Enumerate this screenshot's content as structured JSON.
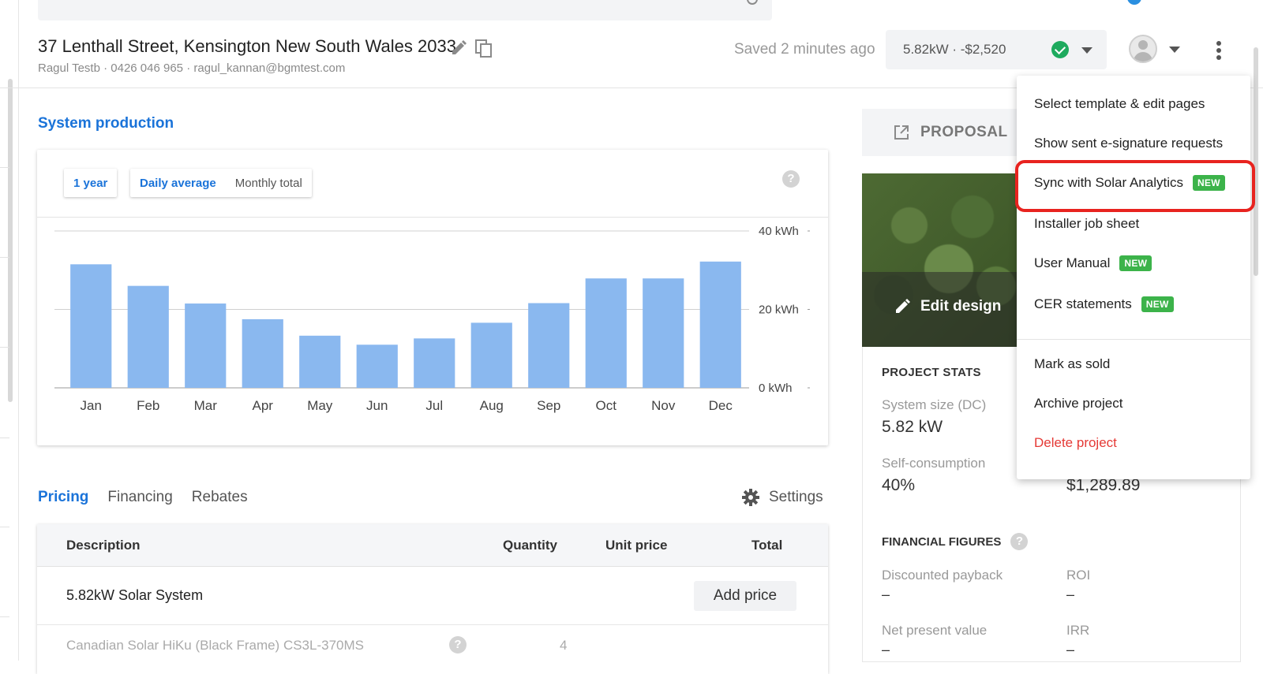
{
  "header": {
    "address": "37 Lenthall Street, Kensington New South Wales 2033",
    "contact": "Ragul Testb · 0426 046 965 · ragul_kannan@bgmtest.com",
    "saved_status": "Saved 2 minutes ago",
    "system_summary": "5.82kW · -$2,520"
  },
  "production": {
    "title": "System production",
    "period_button": "1 year",
    "toggle_daily": "Daily average",
    "toggle_monthly": "Monthly total",
    "help_glyph": "?"
  },
  "chart_data": {
    "type": "bar",
    "categories": [
      "Jan",
      "Feb",
      "Mar",
      "Apr",
      "May",
      "Jun",
      "Jul",
      "Aug",
      "Sep",
      "Oct",
      "Nov",
      "Dec"
    ],
    "values": [
      31.5,
      26,
      21.5,
      17.5,
      13.3,
      11,
      12.6,
      16.6,
      21.6,
      27.9,
      27.9,
      32.2
    ],
    "ylim": [
      0,
      40
    ],
    "yticks": [
      {
        "value": 40,
        "label": "40 kWh"
      },
      {
        "value": 20,
        "label": "20 kWh"
      },
      {
        "value": 0,
        "label": "0 kWh"
      }
    ],
    "bar_color": "#8ab8ef",
    "grid": true
  },
  "pricing": {
    "tabs": [
      "Pricing",
      "Financing",
      "Rebates"
    ],
    "settings_label": "Settings",
    "columns": {
      "description": "Description",
      "quantity": "Quantity",
      "unit_price": "Unit price",
      "total": "Total"
    },
    "rows": [
      {
        "description": "5.82kW Solar System",
        "action": "Add price"
      },
      {
        "description": "Canadian Solar HiKu (Black Frame) CS3L-370MS",
        "quantity": "4"
      }
    ]
  },
  "right_panel": {
    "proposal_label": "PROPOSAL",
    "edit_design_label": "Edit design",
    "project_stats_title": "PROJECT STATS",
    "system_size_label": "System size (DC)",
    "system_size_value": "5.82 kW",
    "self_consumption_label": "Self-consumption",
    "self_consumption_value": "40%",
    "partial_value": "$1,289.89",
    "financial_title": "FINANCIAL FIGURES",
    "discounted_payback_label": "Discounted payback",
    "discounted_payback_value": "–",
    "roi_label": "ROI",
    "roi_value": "–",
    "npv_label": "Net present value",
    "npv_value": "–",
    "irr_label": "IRR",
    "irr_value": "–"
  },
  "menu": {
    "items": [
      {
        "label": "Select template & edit pages"
      },
      {
        "label": "Show sent e-signature requests"
      },
      {
        "label": "Sync with Solar Analytics",
        "badge": "NEW"
      },
      {
        "label": "Installer job sheet"
      },
      {
        "label": "User Manual",
        "badge": "NEW"
      },
      {
        "label": "CER statements",
        "badge": "NEW"
      },
      {
        "label": "Mark as sold"
      },
      {
        "label": "Archive project"
      },
      {
        "label": "Delete project"
      }
    ]
  },
  "colors": {
    "accent": "#1a73d9",
    "success": "#1eaa5e",
    "badge_new": "#3cb34a",
    "danger": "#e53935",
    "highlight": "#e8231f"
  },
  "icons": [
    "pencil-icon",
    "copy-icon",
    "check-icon",
    "caret-down-icon",
    "avatar-icon",
    "kebab-icon",
    "help-icon",
    "gear-icon",
    "external-link-icon",
    "edit-icon"
  ]
}
